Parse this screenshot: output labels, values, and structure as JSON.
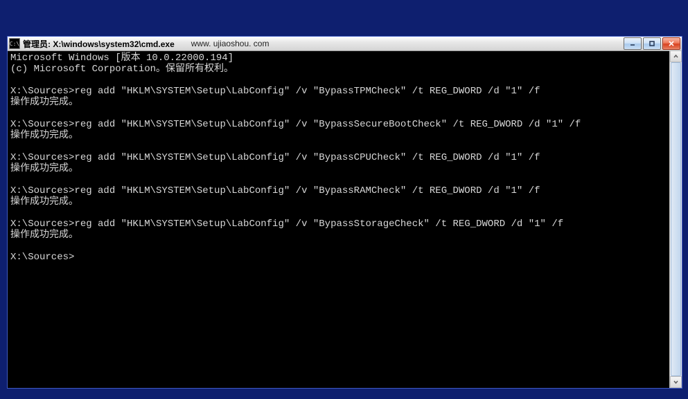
{
  "window": {
    "icon_label": "C:\\",
    "title": "管理员: X:\\windows\\system32\\cmd.exe",
    "url_caption": "www. ujiaoshou. com"
  },
  "terminal": {
    "lines": [
      "Microsoft Windows [版本 10.0.22000.194]",
      "(c) Microsoft Corporation。保留所有权利。",
      "",
      "X:\\Sources>reg add \"HKLM\\SYSTEM\\Setup\\LabConfig\" /v \"BypassTPMCheck\" /t REG_DWORD /d \"1\" /f",
      "操作成功完成。",
      "",
      "X:\\Sources>reg add \"HKLM\\SYSTEM\\Setup\\LabConfig\" /v \"BypassSecureBootCheck\" /t REG_DWORD /d \"1\" /f",
      "操作成功完成。",
      "",
      "X:\\Sources>reg add \"HKLM\\SYSTEM\\Setup\\LabConfig\" /v \"BypassCPUCheck\" /t REG_DWORD /d \"1\" /f",
      "操作成功完成。",
      "",
      "X:\\Sources>reg add \"HKLM\\SYSTEM\\Setup\\LabConfig\" /v \"BypassRAMCheck\" /t REG_DWORD /d \"1\" /f",
      "操作成功完成。",
      "",
      "X:\\Sources>reg add \"HKLM\\SYSTEM\\Setup\\LabConfig\" /v \"BypassStorageCheck\" /t REG_DWORD /d \"1\" /f",
      "操作成功完成。",
      "",
      "X:\\Sources>"
    ]
  }
}
